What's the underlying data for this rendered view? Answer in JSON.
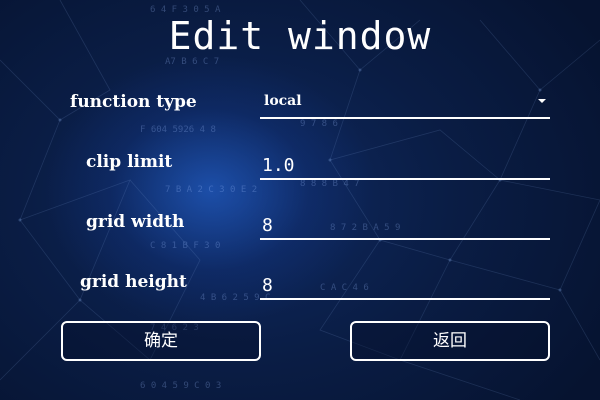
{
  "window": {
    "title": "Edit window"
  },
  "form": {
    "function_type": {
      "label": "function type",
      "value": "local"
    },
    "clip_limit": {
      "label": "clip limit",
      "value": "1.0"
    },
    "grid_width": {
      "label": "grid width",
      "value": "8"
    },
    "grid_height": {
      "label": "grid height",
      "value": "8"
    }
  },
  "buttons": {
    "confirm_label": "确定",
    "back_label": "返回"
  },
  "theme": {
    "background": "#0a1d45",
    "glow": "#2a6ee6",
    "text": "#ffffff"
  },
  "icons": {
    "dropdown": "chevron-down-icon"
  }
}
